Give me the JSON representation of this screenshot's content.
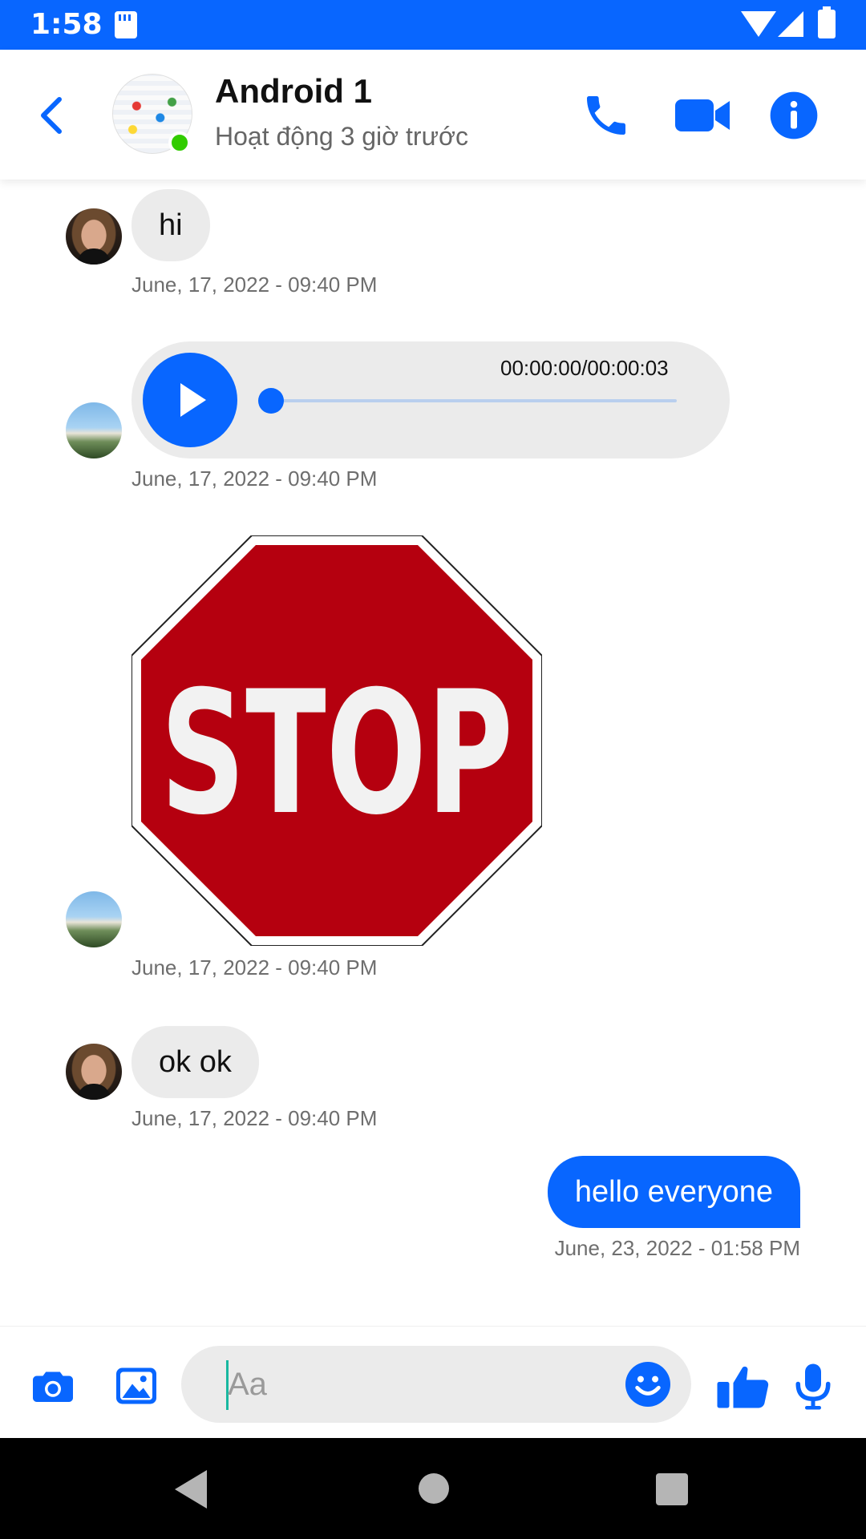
{
  "status_bar": {
    "time": "1:58"
  },
  "header": {
    "title": "Android 1",
    "status": "Hoạt động 3 giờ trước"
  },
  "messages": [
    {
      "text": "hi",
      "time": "June, 17, 2022 - 09:40 PM"
    },
    {
      "audio_time": "00:00:00/00:00:03",
      "progress": 0,
      "time": "June, 17, 2022 - 09:40 PM"
    },
    {
      "sticker_text": "STOP",
      "time": "June, 17, 2022 - 09:40 PM"
    },
    {
      "text": "ok ok",
      "time": "June, 17, 2022 - 09:40 PM"
    },
    {
      "text": "hello everyone",
      "time": "June, 23, 2022 - 01:58 PM"
    }
  ],
  "composer": {
    "placeholder": "Aa"
  },
  "colors": {
    "brand": "#0866ff",
    "stop_red": "#b5000f",
    "online": "#31cc00"
  }
}
